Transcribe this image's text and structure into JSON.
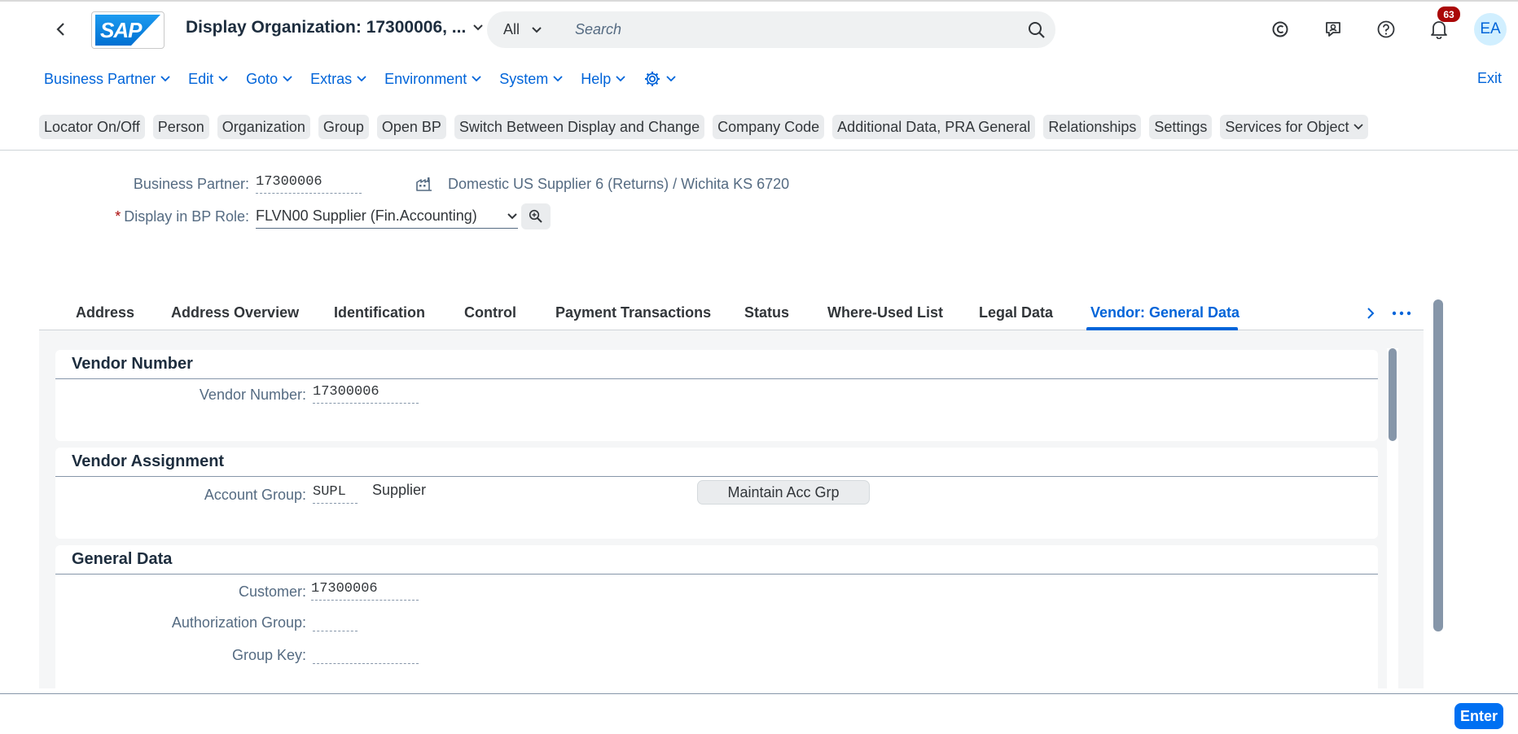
{
  "shell": {
    "title": "Display Organization: 17300006, ...",
    "search_scope": "All",
    "search_placeholder": "Search",
    "notification_count": "63",
    "avatar_initials": "EA",
    "logo_text": "SAP"
  },
  "menu": {
    "items": [
      "Business Partner",
      "Edit",
      "Goto",
      "Extras",
      "Environment",
      "System",
      "Help"
    ],
    "exit": "Exit"
  },
  "toolbar": {
    "buttons": [
      "Locator On/Off",
      "Person",
      "Organization",
      "Group",
      "Open BP",
      "Switch Between Display and Change",
      "Company Code",
      "Additional Data, PRA General",
      "Relationships",
      "Settings",
      "Services for Object"
    ]
  },
  "header_form": {
    "bp_label": "Business Partner:",
    "bp_value": "17300006",
    "bp_description": "Domestic US Supplier 6 (Returns) / Wichita KS 6720",
    "role_required": "*",
    "role_label": "Display in BP Role:",
    "role_value": "FLVN00 Supplier (Fin.Accounting)"
  },
  "tabs": {
    "items": [
      "Address",
      "Address Overview",
      "Identification",
      "Control",
      "Payment Transactions",
      "Status",
      "Where-Used List",
      "Legal Data",
      "Vendor: General Data"
    ],
    "active": "Vendor: General Data"
  },
  "sections": {
    "vendor_number": {
      "title": "Vendor Number",
      "label": "Vendor Number:",
      "value": "17300006"
    },
    "vendor_assignment": {
      "title": "Vendor Assignment",
      "label": "Account Group:",
      "value": "SUPL",
      "description": "Supplier",
      "button": "Maintain Acc Grp"
    },
    "general_data": {
      "title": "General Data",
      "customer_label": "Customer:",
      "customer_value": "17300006",
      "auth_label": "Authorization Group:",
      "auth_value": "",
      "group_label": "Group Key:",
      "group_value": ""
    }
  },
  "footer": {
    "enter": "Enter"
  },
  "colors": {
    "accent": "#0064d9",
    "badge": "#aa0808",
    "enter_button": "#0070f2"
  }
}
